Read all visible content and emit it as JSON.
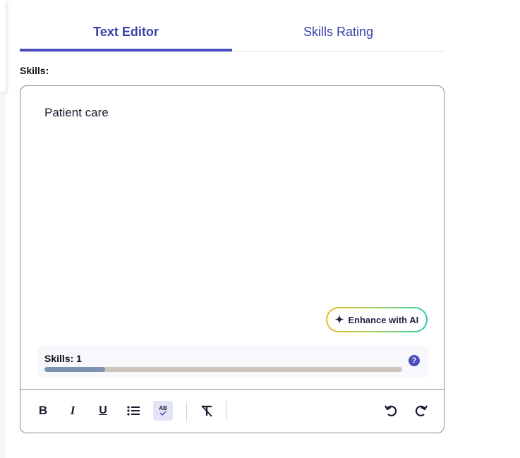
{
  "tabs": [
    {
      "label": "Text Editor",
      "active": true
    },
    {
      "label": "Skills Rating",
      "active": false
    }
  ],
  "skills_label": "Skills:",
  "editor": {
    "content": "Patient care",
    "enhance_button": {
      "label": "Enhance with AI",
      "icon": "sparkle-icon"
    },
    "skills_meter": {
      "label": "Skills: 1",
      "progress": 0.17,
      "help_icon": "?"
    }
  },
  "toolbar": {
    "bold": "B",
    "italic": "I",
    "underline": "U",
    "list_icon": "bullet-list-icon",
    "spellcheck_text": "AB",
    "clear_format_icon": "clear-formatting-icon",
    "undo_icon": "undo-icon",
    "redo_icon": "redo-icon"
  },
  "colors": {
    "accent": "#4a4ec0",
    "progress_fill": "#7b93b1",
    "progress_track": "#cbc6be"
  }
}
